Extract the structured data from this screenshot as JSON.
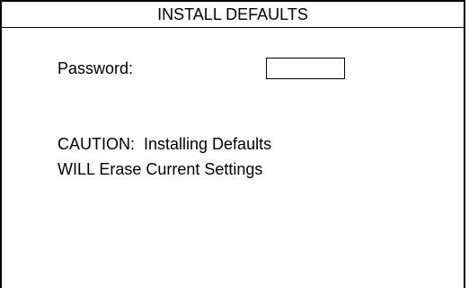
{
  "dialog": {
    "title": "INSTALL DEFAULTS"
  },
  "password": {
    "label": "Password:",
    "value": "",
    "placeholder": ""
  },
  "caution": {
    "line1": "CAUTION:  Installing Defaults",
    "line2": "WILL Erase Current Settings"
  },
  "colors": {
    "background": "#ffffff",
    "foreground": "#000000"
  }
}
